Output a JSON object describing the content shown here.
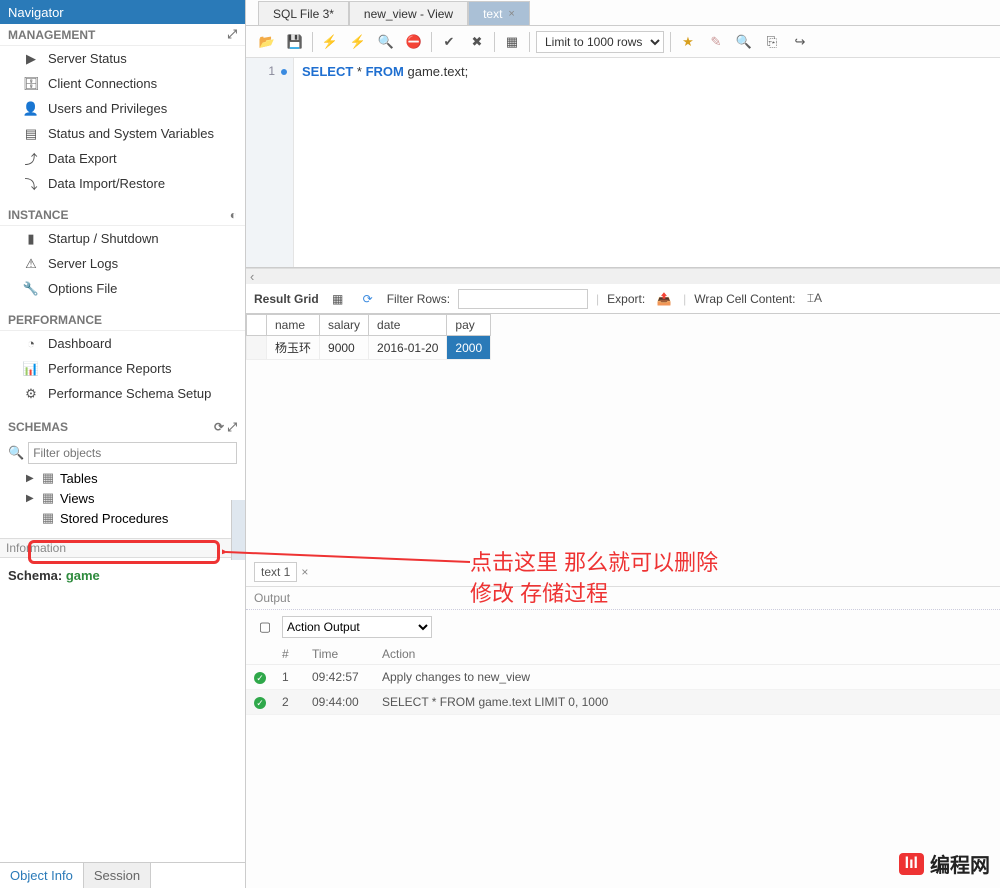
{
  "sidebar": {
    "navigator": "Navigator",
    "management": "MANAGEMENT",
    "mgmt_items": [
      "Server Status",
      "Client Connections",
      "Users and Privileges",
      "Status and System Variables",
      "Data Export",
      "Data Import/Restore"
    ],
    "instance": "INSTANCE",
    "inst_items": [
      "Startup / Shutdown",
      "Server Logs",
      "Options File"
    ],
    "performance": "PERFORMANCE",
    "perf_items": [
      "Dashboard",
      "Performance Reports",
      "Performance Schema Setup"
    ],
    "schemas": "SCHEMAS",
    "filter_placeholder": "Filter objects",
    "tree": {
      "tables": "Tables",
      "views": "Views",
      "stored_procedures": "Stored Procedures"
    },
    "information": "Information",
    "schema_label": "Schema:",
    "schema_value": "game",
    "tabs": {
      "object": "Object Info",
      "session": "Session"
    }
  },
  "main": {
    "tabs": [
      {
        "label": "SQL File 3*",
        "active": false
      },
      {
        "label": "new_view - View",
        "active": false
      },
      {
        "label": "text",
        "active": true
      }
    ],
    "limit_label": "Limit to 1000 rows",
    "editor": {
      "line_no": "1",
      "sql_kw1": "SELECT",
      "sql_star": " * ",
      "sql_kw2": "FROM",
      "sql_tail": " game.text;"
    },
    "result_toolbar": {
      "label": "Result Grid",
      "filter": "Filter Rows:",
      "export": "Export:",
      "wrap": "Wrap Cell Content:"
    },
    "grid": {
      "headers": [
        "name",
        "salary",
        "date",
        "pay"
      ],
      "rows": [
        {
          "name": "杨玉环",
          "salary": "9000",
          "date": "2016-01-20",
          "pay": "2000"
        }
      ]
    },
    "subtab": "text 1",
    "output_hdr": "Output",
    "output_type": "Action Output",
    "log_headers": [
      "#",
      "Time",
      "Action"
    ],
    "log": [
      {
        "n": "1",
        "time": "09:42:57",
        "action": "Apply changes to new_view"
      },
      {
        "n": "2",
        "time": "09:44:00",
        "action": "SELECT * FROM game.text LIMIT 0, 1000"
      }
    ]
  },
  "annotation": {
    "line1": "点击这里 那么就可以删除",
    "line2": "修改 存储过程"
  },
  "watermark": {
    "logo": "lıl",
    "text": "编程网"
  }
}
